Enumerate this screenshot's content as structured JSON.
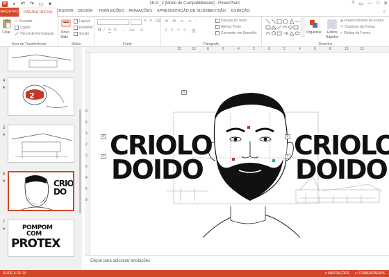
{
  "window": {
    "title": "16-9-_2 [Modo de Compatibilidade] - PowerPoint",
    "controls": [
      "?",
      "▭",
      "—",
      "□",
      "✕"
    ]
  },
  "tabs": {
    "file": "ARQUIVO",
    "items": [
      "PÁGINA INICIAL",
      "INSERIR",
      "DESIGN",
      "TRANSIÇÕES",
      "ANIMAÇÕES",
      "APRESENTAÇÃO DE SLIDES",
      "REVISÃO",
      "EXIBIÇÃO"
    ],
    "active_index": 0
  },
  "ribbon": {
    "clipboard": {
      "paste": "Colar",
      "cut": "Recortar",
      "copy": "Copiar",
      "format_painter": "Pincel de Formatação",
      "label": "Área de Transferência"
    },
    "slides": {
      "new_slide_1": "Novo",
      "new_slide_2": "Slide",
      "layout": "Layout",
      "reset": "Redefinir",
      "section": "Seção",
      "label": "Slides"
    },
    "font": {
      "label": "Fonte",
      "bold": "N",
      "italic": "I",
      "underline": "S",
      "strike": "S"
    },
    "paragraph": {
      "text_direction": "Direção do Texto",
      "align_text": "Alinhar Texto",
      "smartart": "Converter em SmartArt",
      "label": "Parágrafo"
    },
    "drawing": {
      "arrange": "Organizar",
      "quick_styles_1": "Estilos",
      "quick_styles_2": "Rápidos",
      "shape_fill": "Preenchimento da Forma",
      "shape_outline": "Contorno da Forma",
      "shape_effects": "Efeitos de Forma",
      "label": "Desenho"
    }
  },
  "ruler": {
    "h_numbers": [
      "12",
      "10",
      "8",
      "6",
      "4",
      "2",
      "0",
      "2",
      "4",
      "6",
      "8",
      "10",
      "12"
    ],
    "v_numbers": [
      "8",
      "6",
      "4",
      "2",
      "0",
      "2",
      "4",
      "6",
      "8"
    ]
  },
  "thumbnails": [
    {
      "number": "",
      "star": ""
    },
    {
      "number": "4",
      "star": "★"
    },
    {
      "number": "5",
      "star": "★"
    },
    {
      "number": "6",
      "star": "★",
      "selected": true,
      "lines": [
        "CRIO",
        "DO"
      ]
    },
    {
      "number": "7",
      "star": "★",
      "lines": [
        "POMPOM",
        "COM",
        "PROTEX"
      ]
    }
  ],
  "slide": {
    "left_line1": "CRIOLO",
    "left_line2": "DOIDO",
    "right_line1": "CRIOLO",
    "right_line2": "DOIDO",
    "tags": [
      "0",
      "0",
      "0",
      "0",
      "0"
    ]
  },
  "notes": {
    "placeholder": "Clique para adicionar anotações"
  },
  "status": {
    "slide_info": "SLIDE 6 DE 10",
    "notes": "ANOTAÇÕES",
    "comments": "COMENTÁRIOS"
  },
  "colors": {
    "accent": "#d24726"
  }
}
